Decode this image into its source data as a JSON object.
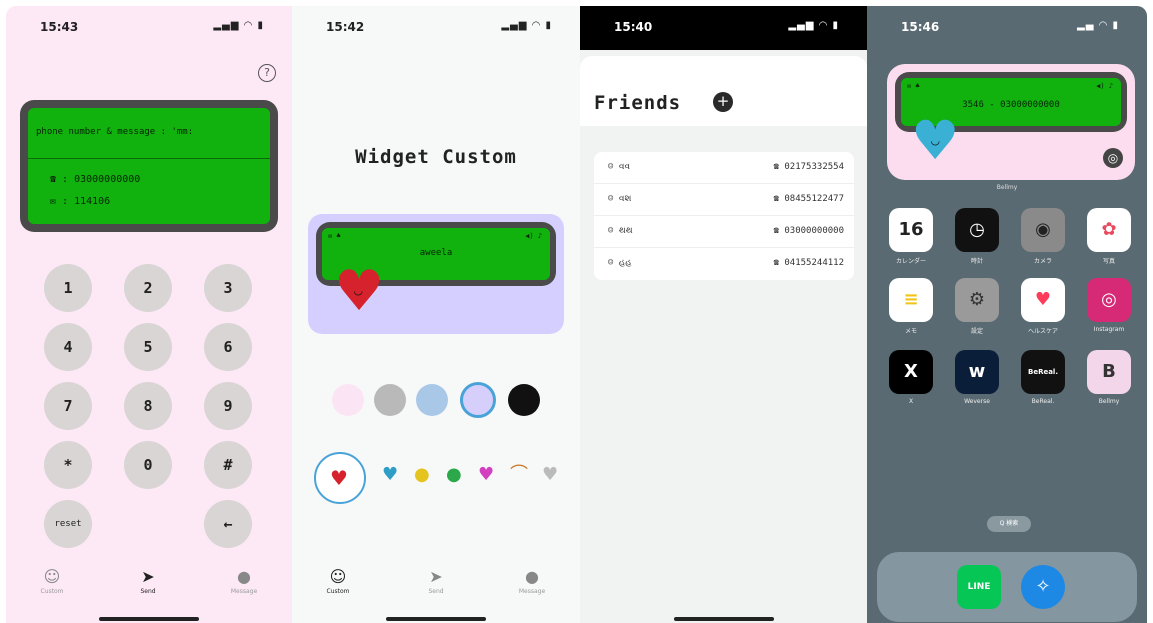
{
  "phone1": {
    "time": "15:43",
    "signal": "▂▄▆ ◠ ▮",
    "help_glyph": "?",
    "lcd": {
      "line1": "phone number & message : 'mm:",
      "phone_line": "☎ : 03000000000",
      "msg_line": "✉ : 114106"
    },
    "keys": [
      "1",
      "2",
      "3",
      "4",
      "5",
      "6",
      "7",
      "8",
      "9",
      "*",
      "0",
      "#",
      "reset",
      "←"
    ],
    "tabs": [
      {
        "icon": "☺",
        "label": "Custom"
      },
      {
        "icon": "➤",
        "label": "Send"
      },
      {
        "icon": "●",
        "label": "Message"
      }
    ]
  },
  "phone2": {
    "time": "15:42",
    "signal": "▂▄▆ ◠ ▮",
    "title": "Widget Custom",
    "lcd": {
      "top_left": "✉ ♣",
      "top_right": "◀) ♪",
      "mid": "aweela"
    },
    "heart": "♥",
    "face": "◡",
    "swatches": [
      "#fbe4f3",
      "#b9b9b9",
      "#a9c8e8",
      "#d6cffb",
      "#111111"
    ],
    "emojis": [
      {
        "glyph": "♥",
        "color": "#d6222c"
      },
      {
        "glyph": "♥",
        "color": "#2e9ec7"
      },
      {
        "glyph": "●",
        "color": "#e6c420"
      },
      {
        "glyph": "●",
        "color": "#2aa84a"
      },
      {
        "glyph": "♥",
        "color": "#d23fbf"
      },
      {
        "glyph": "⌒",
        "color": "#c77b2a"
      },
      {
        "glyph": "♥",
        "color": "#bbbbbb"
      }
    ],
    "tabs": [
      {
        "icon": "☺",
        "label": "Custom"
      },
      {
        "icon": "➤",
        "label": "Send"
      },
      {
        "icon": "●",
        "label": "Message"
      }
    ]
  },
  "phone3": {
    "time": "15:40",
    "signal": "▂▄▆ ◠ ▮",
    "title": "Friends",
    "add_glyph": "+",
    "friends": [
      {
        "name": "☺ વવ",
        "phone": "☎ 02175332554"
      },
      {
        "name": "☺ વશ",
        "phone": "☎ 08455122477"
      },
      {
        "name": "☺ થથ",
        "phone": "☎ 03000000000"
      },
      {
        "name": "☺ હહ",
        "phone": "☎ 04155244112"
      }
    ]
  },
  "phone4": {
    "time": "15:46",
    "signal": "▂▄ ◠ ▮",
    "lcd": {
      "top_left": "✉ ♣",
      "top_right": "◀) ♪",
      "mid": "3546 - 03000000000"
    },
    "widget_label": "Bellmy",
    "gear": "◎",
    "apps": [
      {
        "glyph": "16",
        "label": "カレンダー",
        "bg": "#ffffff",
        "fg": "#222222"
      },
      {
        "glyph": "◷",
        "label": "時計",
        "bg": "#111111",
        "fg": "#ffffff"
      },
      {
        "glyph": "◉",
        "label": "カメラ",
        "bg": "#8a8a8a",
        "fg": "#222222"
      },
      {
        "glyph": "✿",
        "label": "写真",
        "bg": "#ffffff",
        "fg": "#e84a5f"
      },
      {
        "glyph": "≡",
        "label": "メモ",
        "bg": "#ffffff",
        "fg": "#f0c419"
      },
      {
        "glyph": "⚙",
        "label": "設定",
        "bg": "#9a9a9a",
        "fg": "#333333"
      },
      {
        "glyph": "♥",
        "label": "ヘルスケア",
        "bg": "#ffffff",
        "fg": "#ff3b5c"
      },
      {
        "glyph": "◎",
        "label": "Instagram",
        "bg": "#d62976",
        "fg": "#ffffff"
      },
      {
        "glyph": "X",
        "label": "X",
        "bg": "#000000",
        "fg": "#ffffff"
      },
      {
        "glyph": "w",
        "label": "Weverse",
        "bg": "#0a1e3a",
        "fg": "#ffffff"
      },
      {
        "glyph": "BeReal.",
        "label": "BeReal.",
        "bg": "#111111",
        "fg": "#ffffff"
      },
      {
        "glyph": "B",
        "label": "Bellmy",
        "bg": "#f4d6ea",
        "fg": "#333333"
      }
    ],
    "search": "Q 検索",
    "dock": [
      {
        "glyph": "LINE",
        "bg": "#06c755",
        "fg": "#ffffff"
      },
      {
        "glyph": "✧",
        "bg": "#1e88e5",
        "fg": "#ffffff"
      }
    ]
  }
}
